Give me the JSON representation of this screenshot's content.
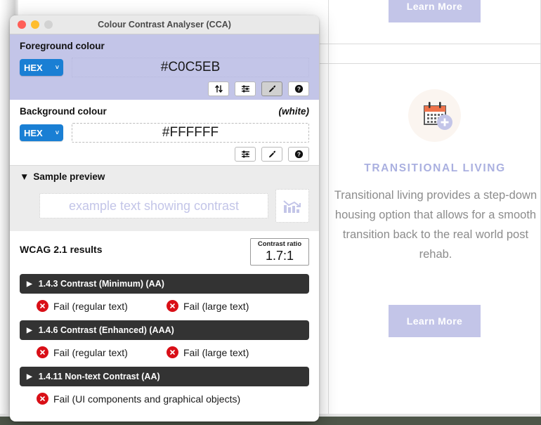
{
  "background_page": {
    "cta_top_label": "Learn More",
    "cta_bottom_label": "Learn More",
    "card_heading": "TRANSITIONAL LIVING",
    "card_body": "Transitional living provides a step-down housing option that allows for a smooth transition back to the real world post rehab.",
    "icon_name": "calendar-plus-icon",
    "accent_color": "#c3c5e8",
    "body_text_color": "#8c8c8c"
  },
  "cca": {
    "window_title": "Colour Contrast Analyser (CCA)",
    "traffic_lights": [
      "close",
      "minimize",
      "zoom"
    ],
    "foreground": {
      "label": "Foreground colour",
      "format_value": "HEX",
      "chevron": "˅",
      "colour_value": "#C0C5EB",
      "panel_color": "#c3c5e8",
      "tools": [
        {
          "name": "swap-colours-icon",
          "glyph": "↑↓",
          "active": false
        },
        {
          "name": "colour-sliders-icon",
          "glyph": "sliders",
          "active": false
        },
        {
          "name": "eyedropper-icon",
          "glyph": "eyedropper",
          "active": true
        },
        {
          "name": "help-icon",
          "glyph": "?",
          "active": false
        }
      ]
    },
    "background": {
      "label": "Background colour",
      "note": "(white)",
      "format_value": "HEX",
      "chevron": "˅",
      "colour_value": "#FFFFFF",
      "tools": [
        {
          "name": "colour-sliders-icon",
          "glyph": "sliders",
          "active": false
        },
        {
          "name": "eyedropper-icon",
          "glyph": "eyedropper",
          "active": false
        },
        {
          "name": "help-icon",
          "glyph": "?",
          "active": false
        }
      ]
    },
    "sample_preview": {
      "disclosure_glyph": "▼",
      "label": "Sample preview",
      "sample_text": "example text showing contrast",
      "graphic_name": "bar-chart-sample-icon"
    },
    "results": {
      "title": "WCAG 2.1 results",
      "ratio_label": "Contrast ratio",
      "ratio_value": "1.7:1",
      "criteria": [
        {
          "disclosure_glyph": "▶",
          "title": "1.4.3 Contrast (Minimum) (AA)",
          "outcomes": [
            {
              "status": "fail",
              "text": "Fail (regular text)"
            },
            {
              "status": "fail",
              "text": "Fail (large text)"
            }
          ]
        },
        {
          "disclosure_glyph": "▶",
          "title": "1.4.6 Contrast (Enhanced) (AAA)",
          "outcomes": [
            {
              "status": "fail",
              "text": "Fail (regular text)"
            },
            {
              "status": "fail",
              "text": "Fail (large text)"
            }
          ]
        },
        {
          "disclosure_glyph": "▶",
          "title": "1.4.11 Non-text Contrast (AA)",
          "outcomes": [
            {
              "status": "fail",
              "text": "Fail (UI components and graphical objects)"
            }
          ]
        }
      ],
      "fail_color": "#d90f17"
    }
  }
}
